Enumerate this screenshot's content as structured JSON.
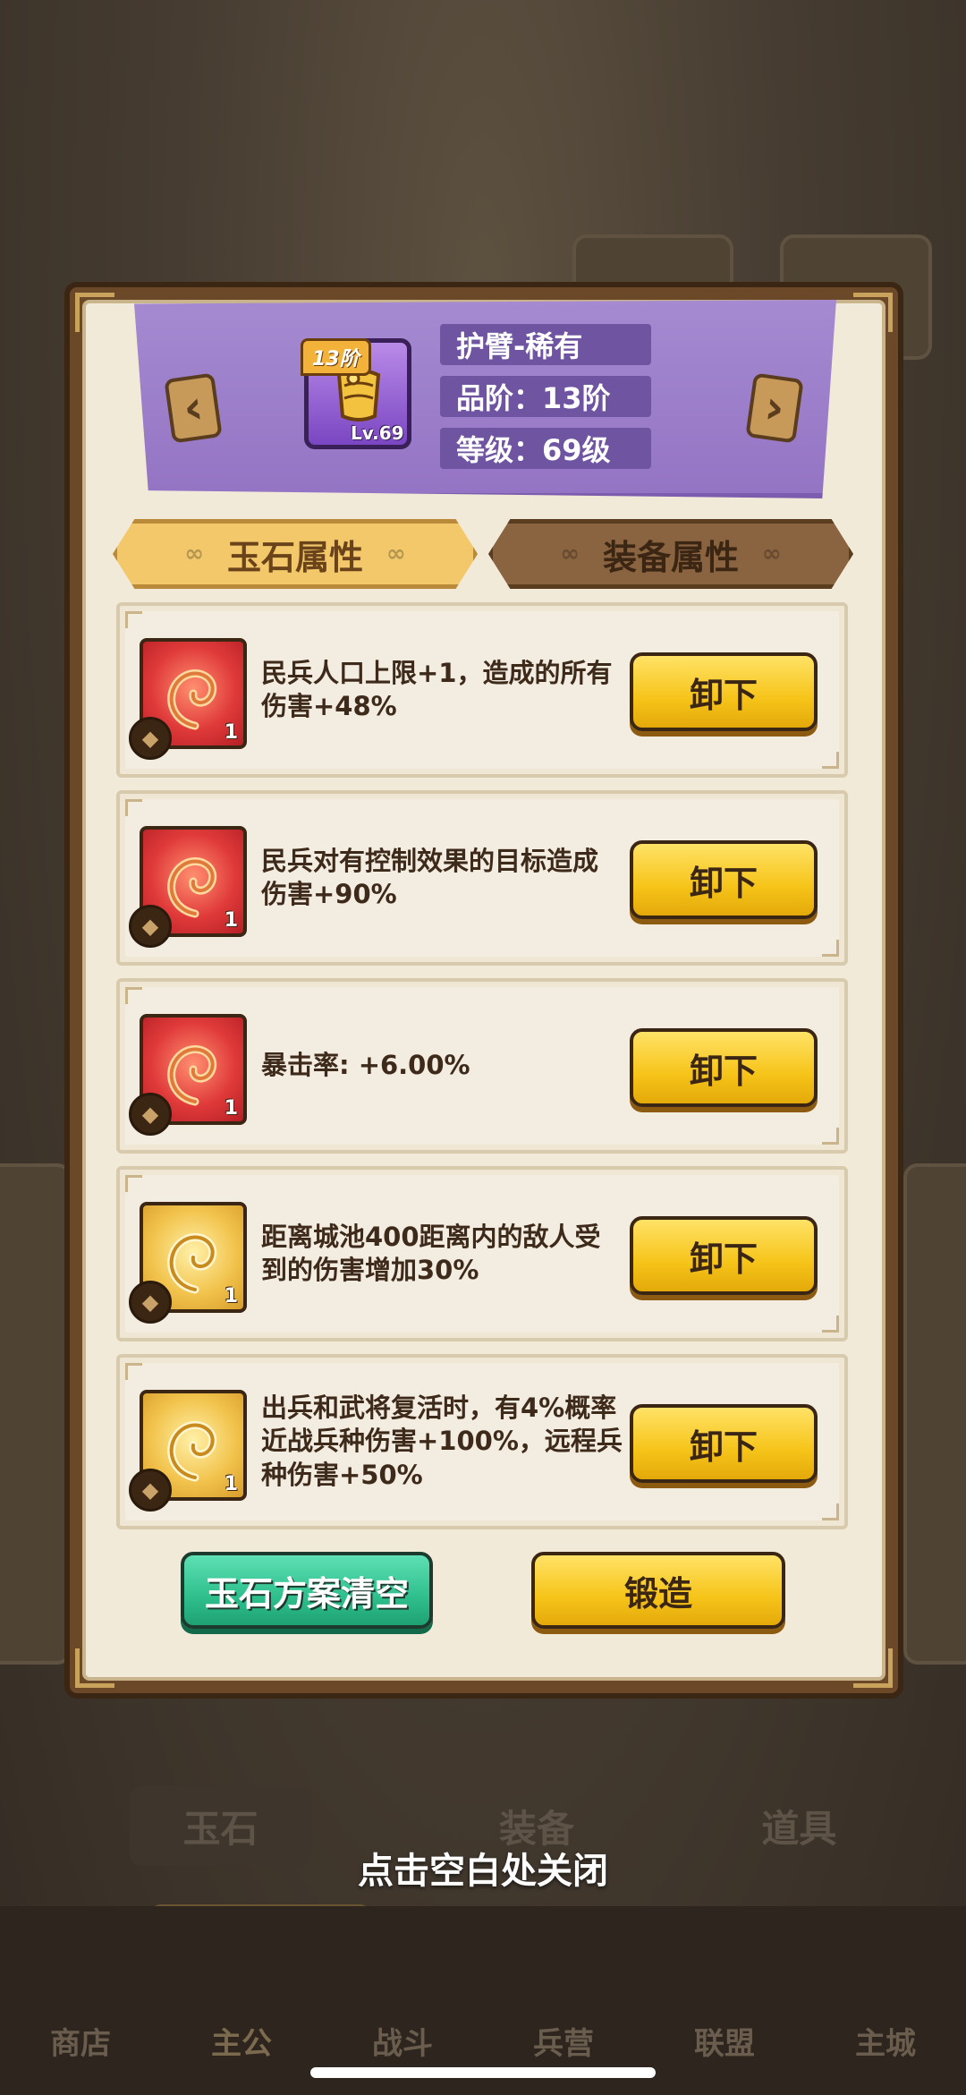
{
  "background": {
    "tabs": [
      "玉石",
      "装备",
      "道具"
    ],
    "nav": [
      "商店",
      "主公",
      "战斗",
      "兵营",
      "联盟",
      "主城"
    ],
    "active_nav": "主公"
  },
  "header": {
    "tier_tag": "13阶",
    "item_level": "Lv.69",
    "item_icon": "bracer-icon",
    "name": "护臂-稀有",
    "quality": "品阶：13阶",
    "level": "等级：69级",
    "prev_icon": "chevron-left-icon",
    "next_icon": "chevron-right-icon"
  },
  "tabs": {
    "active": "玉石属性",
    "inactive": "装备属性"
  },
  "slots": [
    {
      "gem_color": "red",
      "count": "1",
      "text": "民兵人口上限+1，造成的所有伤害+48%",
      "button": "卸下"
    },
    {
      "gem_color": "red",
      "count": "1",
      "text": "民兵对有控制效果的目标造成伤害+90%",
      "button": "卸下"
    },
    {
      "gem_color": "red",
      "count": "1",
      "text": "暴击率: +6.00%",
      "button": "卸下"
    },
    {
      "gem_color": "gold",
      "count": "1",
      "text": "距离城池400距离内的敌人受到的伤害增加30%",
      "button": "卸下"
    },
    {
      "gem_color": "gold",
      "count": "1",
      "text": "出兵和武将复活时，有4%概率近战兵种伤害+100%，远程兵种伤害+50%",
      "button": "卸下"
    }
  ],
  "actions": {
    "clear": "玉石方案清空",
    "forge": "锻造"
  },
  "close_hint": "点击空白处关闭",
  "colors": {
    "banner": "#9474c4",
    "gem_red": "#e03a3a",
    "gem_gold": "#f2c44e",
    "button_yellow": "#f6c419",
    "button_green": "#2fbf8d"
  }
}
